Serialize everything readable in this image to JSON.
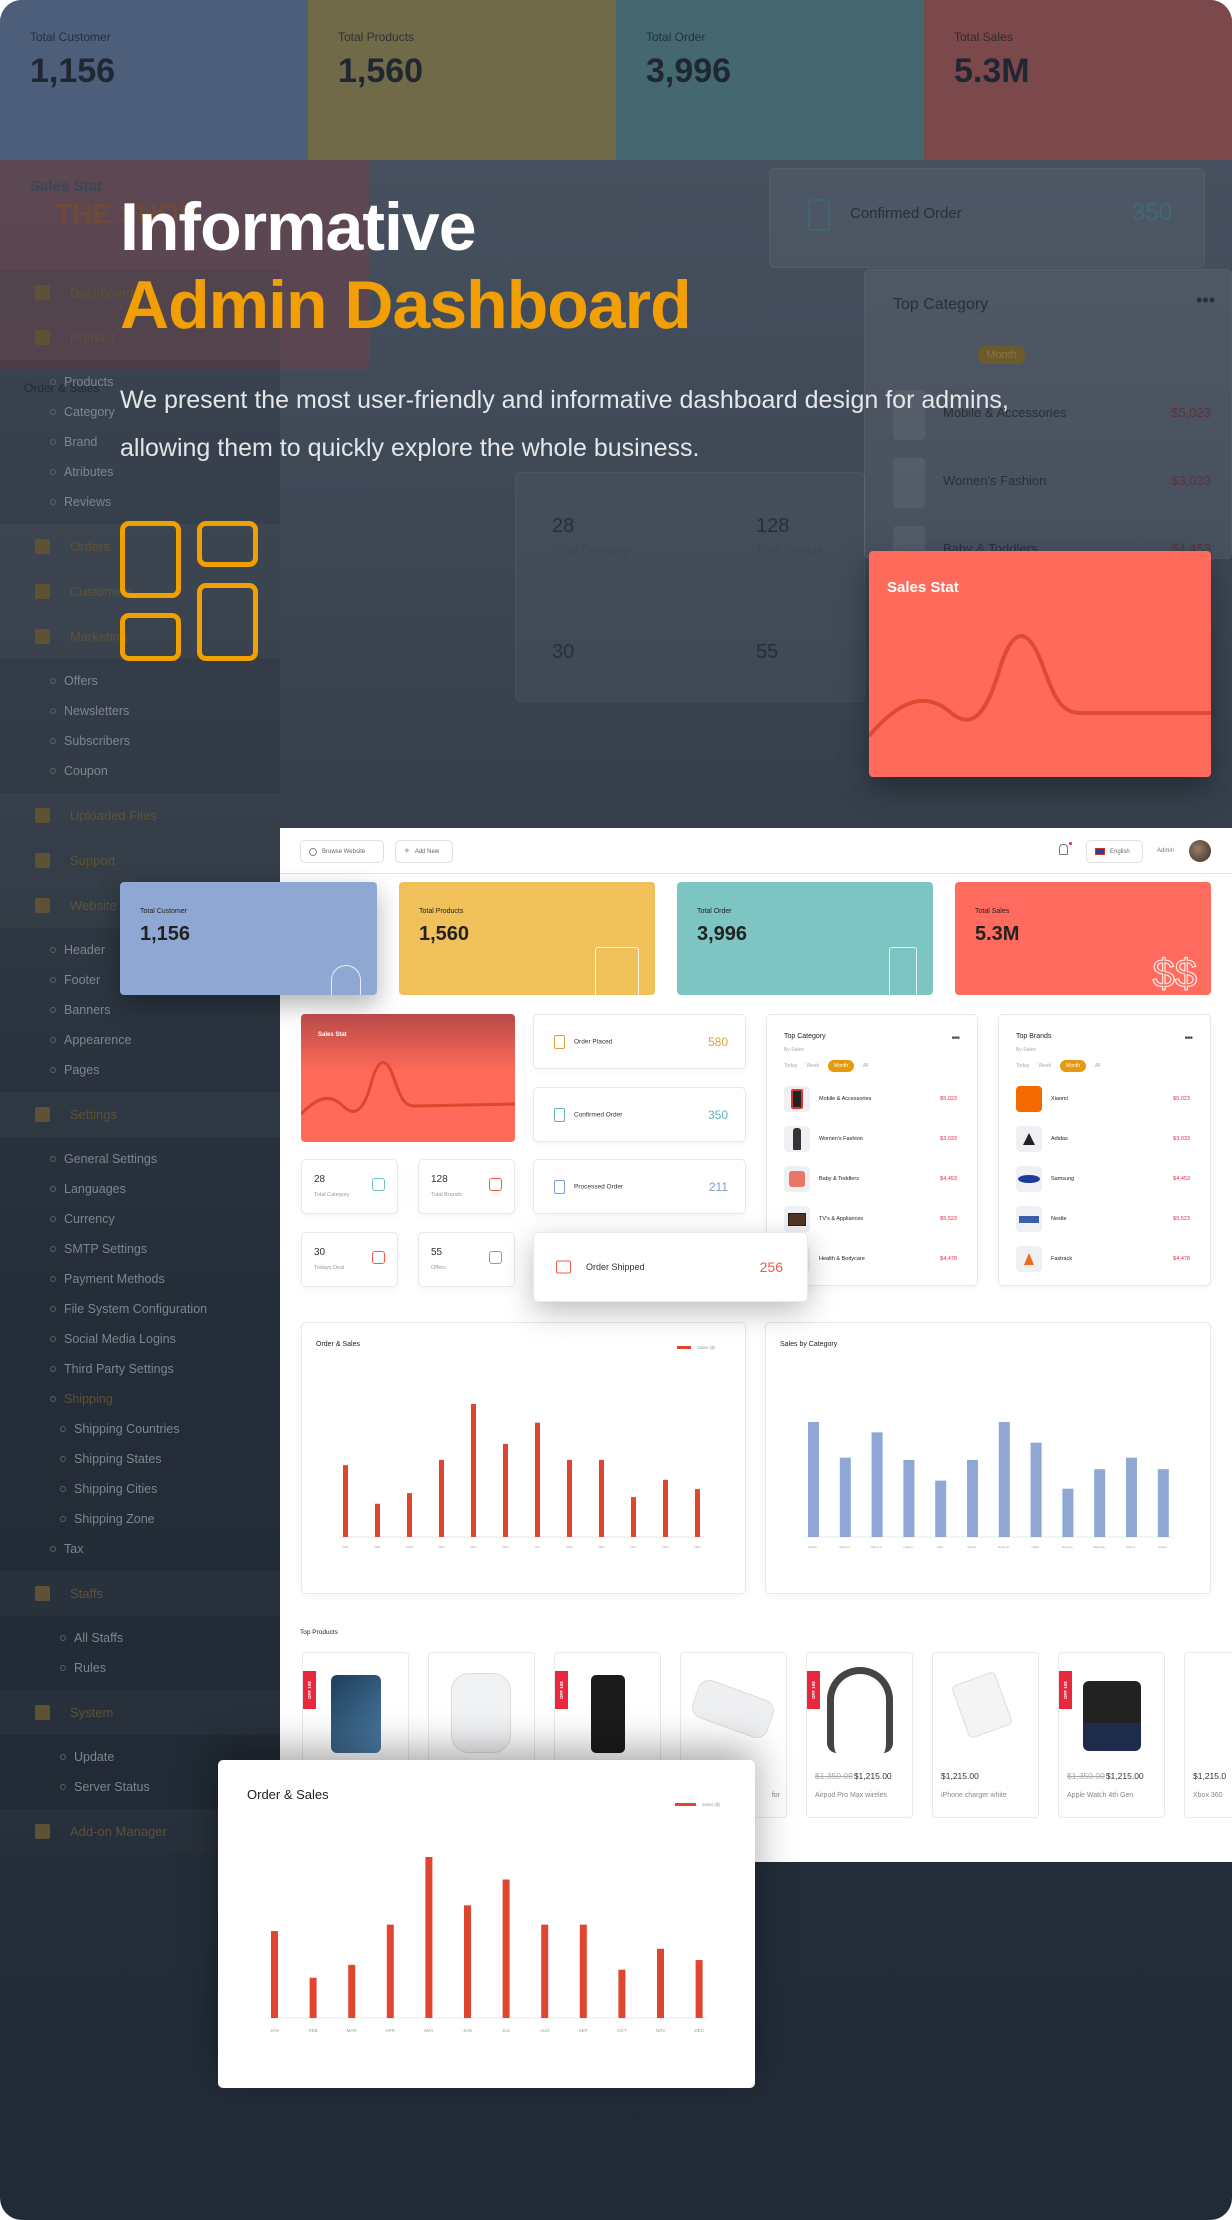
{
  "hero": {
    "title_line1": "Informative",
    "title_line2": "Admin Dashboard",
    "description": "We present the most user-friendly and informative dashboard design for admins, allowing them to quickly explore the whole business.",
    "icon": "dashboard-grid-icon"
  },
  "colors": {
    "accent": "#f29f05",
    "customer": "#8fa8d3",
    "products": "#f0c05a",
    "order": "#7cc5c2",
    "sales": "#ff6b5e",
    "bar_sales": "#e0452f",
    "bar_category": "#8fa8d3",
    "price": "#e8284a"
  },
  "background": {
    "kpis": [
      {
        "label": "Total Customer",
        "value": "1,156"
      },
      {
        "label": "Total Products",
        "value": "1,560"
      },
      {
        "label": "Total Order",
        "value": "3,996"
      },
      {
        "label": "Total Sales",
        "value": "5.3M"
      }
    ],
    "sales_stat": "Sales Stat",
    "brand": "THE SHOP",
    "order_sales": "Order & Sales",
    "confirmed_order": {
      "label": "Confirmed Order",
      "value": "350"
    },
    "top_category": {
      "title": "Top Category",
      "subtitle": "By Sales",
      "filters": [
        "Today",
        "Week",
        "Month",
        "All"
      ],
      "items": [
        {
          "name": "Mobile & Accessories",
          "value": "$5,023"
        },
        {
          "name": "Women's Fashion",
          "value": "$3,033"
        },
        {
          "name": "Baby & Toddlers",
          "value": "$4,453"
        }
      ]
    },
    "tiles": [
      {
        "value": "28",
        "label": "Total Category"
      },
      {
        "value": "128",
        "label": "Total Brands"
      },
      {
        "value": "30",
        "label": ""
      },
      {
        "value": "55",
        "label": ""
      }
    ],
    "sidebar": [
      {
        "label": "Dashboard",
        "type": "section",
        "icon": "dashboard-icon"
      },
      {
        "label": "Product",
        "type": "section",
        "icon": "product-icon"
      },
      {
        "label": "Products",
        "type": "sub"
      },
      {
        "label": "Category",
        "type": "sub"
      },
      {
        "label": "Brand",
        "type": "sub"
      },
      {
        "label": "Atributes",
        "type": "sub"
      },
      {
        "label": "Reviews",
        "type": "sub"
      },
      {
        "label": "Orders",
        "type": "section",
        "icon": "orders-icon"
      },
      {
        "label": "Customers",
        "type": "section",
        "icon": "customers-icon"
      },
      {
        "label": "Marketing",
        "type": "section",
        "icon": "megaphone-icon"
      },
      {
        "label": "Offers",
        "type": "sub"
      },
      {
        "label": "Newsletters",
        "type": "sub"
      },
      {
        "label": "Subscribers",
        "type": "sub"
      },
      {
        "label": "Coupon",
        "type": "sub"
      },
      {
        "label": "Uploaded Files",
        "type": "section",
        "icon": "files-icon"
      },
      {
        "label": "Support",
        "type": "section",
        "icon": "chat-icon"
      },
      {
        "label": "Website",
        "type": "section",
        "icon": "monitor-icon"
      },
      {
        "label": "Header",
        "type": "sub"
      },
      {
        "label": "Footer",
        "type": "sub"
      },
      {
        "label": "Banners",
        "type": "sub"
      },
      {
        "label": "Appearence",
        "type": "sub"
      },
      {
        "label": "Pages",
        "type": "sub"
      },
      {
        "label": "Settings",
        "type": "section",
        "icon": "gear-icon"
      },
      {
        "label": "General Settings",
        "type": "sub"
      },
      {
        "label": "Languages",
        "type": "sub"
      },
      {
        "label": "Currency",
        "type": "sub"
      },
      {
        "label": "SMTP Settings",
        "type": "sub"
      },
      {
        "label": "Payment Methods",
        "type": "sub"
      },
      {
        "label": "File System Configuration",
        "type": "sub"
      },
      {
        "label": "Social Media Logins",
        "type": "sub"
      },
      {
        "label": "Third Party Settings",
        "type": "sub"
      },
      {
        "label": "Shipping",
        "type": "sub",
        "active": true
      },
      {
        "label": "Shipping Countries",
        "type": "subsub"
      },
      {
        "label": "Shipping States",
        "type": "subsub"
      },
      {
        "label": "Shipping Cities",
        "type": "subsub"
      },
      {
        "label": "Shipping Zone",
        "type": "subsub"
      },
      {
        "label": "Tax",
        "type": "sub"
      },
      {
        "label": "Staffs",
        "type": "section",
        "icon": "user-icon"
      },
      {
        "label": "All Staffs",
        "type": "subsub"
      },
      {
        "label": "Rules",
        "type": "subsub"
      },
      {
        "label": "System",
        "type": "section",
        "icon": "system-icon"
      },
      {
        "label": "Update",
        "type": "subsub"
      },
      {
        "label": "Server Status",
        "type": "subsub"
      },
      {
        "label": "Add-on Manager",
        "type": "section",
        "icon": "puzzle-icon"
      }
    ]
  },
  "sales_stat_card": {
    "title": "Sales Stat"
  },
  "dashboard": {
    "topbar": {
      "browse": "Browse Website",
      "add_new": "Add New",
      "language": "English",
      "user": "Admin"
    },
    "kpis": [
      {
        "label": "Total Customer",
        "value": "1,156",
        "icon": "users-icon"
      },
      {
        "label": "Total Products",
        "value": "1,560",
        "icon": "box-icon"
      },
      {
        "label": "Total Order",
        "value": "3,996",
        "icon": "receipt-icon"
      },
      {
        "label": "Total Sales",
        "value": "5.3M",
        "icon": "dollar-icon"
      }
    ],
    "sales_stat": "Sales Stat",
    "orders": [
      {
        "label": "Order Placed",
        "value": "580",
        "color": "#d9a23a"
      },
      {
        "label": "Confirmed Order",
        "value": "350",
        "color": "#5fb6b1"
      },
      {
        "label": "Processed Order",
        "value": "211",
        "color": "#7f9ccc"
      },
      {
        "label": "Order Shipped",
        "value": "256",
        "color": "#f2584a"
      }
    ],
    "tiles": [
      {
        "value": "28",
        "label": "Total Category",
        "color": "#6ec3be"
      },
      {
        "value": "128",
        "label": "Total Brands",
        "color": "#f2584a"
      },
      {
        "value": "30",
        "label": "Todays Deal",
        "color": "#f2584a"
      },
      {
        "value": "55",
        "label": "Offers",
        "color": "#7f9ccc"
      }
    ],
    "top_category": {
      "title": "Top Category",
      "subtitle": "By Sales",
      "filters": [
        "Today",
        "Week",
        "Month",
        "All"
      ],
      "active_filter": "Month",
      "items": [
        {
          "name": "Mobile & Accessories",
          "value": "$5,023"
        },
        {
          "name": "Women's Fashion",
          "value": "$3,033"
        },
        {
          "name": "Baby & Toddlers",
          "value": "$4,453"
        },
        {
          "name": "TV's & Appliances",
          "value": "$5,523"
        },
        {
          "name": "Health & Bodycare",
          "value": "$4,478"
        }
      ]
    },
    "top_brands": {
      "title": "Top Brands",
      "subtitle": "By Sales",
      "filters": [
        "Today",
        "Week",
        "Month",
        "All"
      ],
      "active_filter": "Month",
      "items": [
        {
          "name": "Xiaomi",
          "value": "$5,023"
        },
        {
          "name": "Adidas",
          "value": "$3,033"
        },
        {
          "name": "Samsung",
          "value": "$4,453"
        },
        {
          "name": "Nestle",
          "value": "$5,523"
        },
        {
          "name": "Fastrack",
          "value": "$4,478"
        }
      ]
    },
    "order_sales": {
      "title": "Order & Sales",
      "legend": "Sales ($)"
    },
    "sales_by_category": {
      "title": "Sales by Category"
    },
    "top_products": {
      "title": "Top Products",
      "items": [
        {
          "name": "",
          "price": "",
          "old_price": "",
          "badge": "OFF 10$",
          "image": "iphone-blue"
        },
        {
          "name": "",
          "price": "",
          "old_price": "",
          "badge": "",
          "image": "airpods"
        },
        {
          "name": "",
          "price": "",
          "old_price": "",
          "badge": "OFF 10$",
          "image": "iphone-black"
        },
        {
          "name": "for",
          "price": "",
          "old_price": "",
          "badge": "",
          "image": "charger-pad"
        },
        {
          "name": "Airpod Pro Max wireles",
          "price": "$1,215.00",
          "old_price": "$1,350.00",
          "badge": "OFF 10$",
          "image": "headphones"
        },
        {
          "name": "iPhone charger white",
          "price": "$1,215.00",
          "old_price": "",
          "badge": "",
          "image": "charger"
        },
        {
          "name": "Apple Watch 4th Gen",
          "price": "$1,215.00",
          "old_price": "$1,350.00",
          "badge": "OFF 10$",
          "image": "watch"
        },
        {
          "name": "Xbox 360",
          "price": "$1,215.0",
          "old_price": "",
          "badge": "",
          "image": "xbox"
        }
      ]
    }
  },
  "chart_data": [
    {
      "type": "bar",
      "title": "Order & Sales",
      "categories": [
        "JAN",
        "FEB",
        "MAR",
        "APR",
        "MAY",
        "JUN",
        "JUL",
        "AUG",
        "SEP",
        "OCT",
        "NOV",
        "DEC"
      ],
      "series": [
        {
          "name": "Sales ($)",
          "values": [
            54,
            25,
            33,
            58,
            100,
            70,
            86,
            58,
            58,
            30,
            43,
            36
          ],
          "color": "#e0452f"
        }
      ],
      "ylim": [
        0,
        100
      ],
      "grid": false,
      "legend": "top-right"
    },
    {
      "type": "bar",
      "title": "Sales by Category",
      "categories": [
        "Mobile..",
        "Women..",
        "Men's F..",
        "Laptop..",
        "Kids..",
        "Sports..",
        "Home D..",
        "Cable..",
        "Grocery..",
        "Watches..",
        "Skin C..",
        "Autom.."
      ],
      "series": [
        {
          "values": [
            100,
            69,
            91,
            67,
            49,
            67,
            100,
            82,
            42,
            59,
            69,
            59
          ],
          "color": "#8fa8d3"
        }
      ],
      "ylim": [
        0,
        100
      ],
      "grid": false
    }
  ]
}
